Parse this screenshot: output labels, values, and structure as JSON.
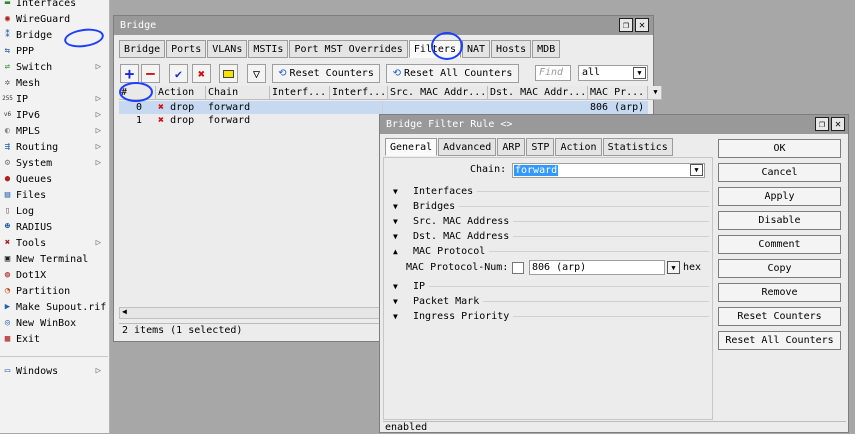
{
  "sidebar": {
    "items": [
      {
        "label": "Interfaces",
        "icon": "interfaces-icon",
        "glyph": "▬",
        "color": "#2a8c2a",
        "arrow": false
      },
      {
        "label": "WireGuard",
        "icon": "wireguard-icon",
        "glyph": "◉",
        "color": "#b02020",
        "arrow": false
      },
      {
        "label": "Bridge",
        "icon": "bridge-icon",
        "glyph": "⁑",
        "color": "#2060b0",
        "arrow": false
      },
      {
        "label": "PPP",
        "icon": "ppp-icon",
        "glyph": "⇆",
        "color": "#2060b0",
        "arrow": false
      },
      {
        "label": "Switch",
        "icon": "switch-icon",
        "glyph": "⇌",
        "color": "#2a8c2a",
        "arrow": true
      },
      {
        "label": "Mesh",
        "icon": "mesh-icon",
        "glyph": "✲",
        "color": "#666666",
        "arrow": false
      },
      {
        "label": "IP",
        "icon": "ip-icon",
        "glyph": "255",
        "color": "#333333",
        "arrow": true
      },
      {
        "label": "IPv6",
        "icon": "ipv6-icon",
        "glyph": "v6",
        "color": "#333333",
        "arrow": true
      },
      {
        "label": "MPLS",
        "icon": "mpls-icon",
        "glyph": "◐",
        "color": "#888888",
        "arrow": true
      },
      {
        "label": "Routing",
        "icon": "routing-icon",
        "glyph": "⇶",
        "color": "#2060b0",
        "arrow": true
      },
      {
        "label": "System",
        "icon": "system-icon",
        "glyph": "⚙",
        "color": "#777777",
        "arrow": true
      },
      {
        "label": "Queues",
        "icon": "queues-icon",
        "glyph": "●",
        "color": "#b02020",
        "arrow": false
      },
      {
        "label": "Files",
        "icon": "files-icon",
        "glyph": "▤",
        "color": "#2060b0",
        "arrow": false
      },
      {
        "label": "Log",
        "icon": "log-icon",
        "glyph": "▯",
        "color": "#666666",
        "arrow": false
      },
      {
        "label": "RADIUS",
        "icon": "radius-icon",
        "glyph": "☻",
        "color": "#2060b0",
        "arrow": false
      },
      {
        "label": "Tools",
        "icon": "tools-icon",
        "glyph": "✖",
        "color": "#b02020",
        "arrow": true
      },
      {
        "label": "New Terminal",
        "icon": "terminal-icon",
        "glyph": "▣",
        "color": "#222222",
        "arrow": false
      },
      {
        "label": "Dot1X",
        "icon": "dot1x-icon",
        "glyph": "◍",
        "color": "#b02020",
        "arrow": false
      },
      {
        "label": "Partition",
        "icon": "partition-icon",
        "glyph": "◔",
        "color": "#c04000",
        "arrow": false
      },
      {
        "label": "Make Supout.rif",
        "icon": "supout-icon",
        "glyph": "▶",
        "color": "#2060b0",
        "arrow": false
      },
      {
        "label": "New WinBox",
        "icon": "winbox-icon",
        "glyph": "◎",
        "color": "#2060b0",
        "arrow": false
      },
      {
        "label": "Exit",
        "icon": "exit-icon",
        "glyph": "▦",
        "color": "#b02020",
        "arrow": false
      }
    ],
    "windows": {
      "label": "Windows",
      "icon": "windows-icon",
      "glyph": "▭",
      "color": "#2060b0"
    }
  },
  "bridge": {
    "title": "Bridge",
    "tabs": [
      "Bridge",
      "Ports",
      "VLANs",
      "MSTIs",
      "Port MST Overrides",
      "Filters",
      "NAT",
      "Hosts",
      "MDB"
    ],
    "active_tab": "Filters",
    "toolbar": {
      "reset_counters": "Reset Counters",
      "reset_all_counters": "Reset All Counters",
      "find_placeholder": "Find",
      "filter_value": "all"
    },
    "columns": [
      "#",
      "Action",
      "Chain",
      "Interf...",
      "Interf...",
      "Src. MAC Addr...",
      "Dst. MAC Addr...",
      "MAC Pr..."
    ],
    "rows": [
      {
        "num": "0",
        "action": "drop",
        "chain": "forward",
        "mac_proto": "806 (arp)",
        "selected": true
      },
      {
        "num": "1",
        "action": "drop",
        "chain": "forward",
        "mac_proto": "",
        "selected": false
      }
    ],
    "status": "2 items (1 selected)"
  },
  "rule": {
    "title": "Bridge Filter Rule <>",
    "tabs": [
      "General",
      "Advanced",
      "ARP",
      "STP",
      "Action",
      "Statistics"
    ],
    "active_tab": "General",
    "chain_label": "Chain:",
    "chain_value": "forward",
    "sections": {
      "interfaces": "Interfaces",
      "bridges": "Bridges",
      "src_mac": "Src. MAC Address",
      "dst_mac": "Dst. MAC Address",
      "mac_protocol": "MAC Protocol",
      "ip": "IP",
      "packet_mark": "Packet Mark",
      "ingress_priority": "Ingress Priority"
    },
    "mac_proto_num_label": "MAC Protocol-Num:",
    "mac_proto_num_value": "806 (arp)",
    "mac_proto_unit": "hex",
    "buttons": {
      "ok": "OK",
      "cancel": "Cancel",
      "apply": "Apply",
      "disable": "Disable",
      "comment": "Comment",
      "copy": "Copy",
      "remove": "Remove",
      "reset_counters": "Reset Counters",
      "reset_all_counters": "Reset All Counters"
    },
    "status": "enabled"
  },
  "colors": {
    "selection": "#c6d9f0",
    "title_bar": "#999999",
    "annotation_ink": "#1c3fff"
  }
}
